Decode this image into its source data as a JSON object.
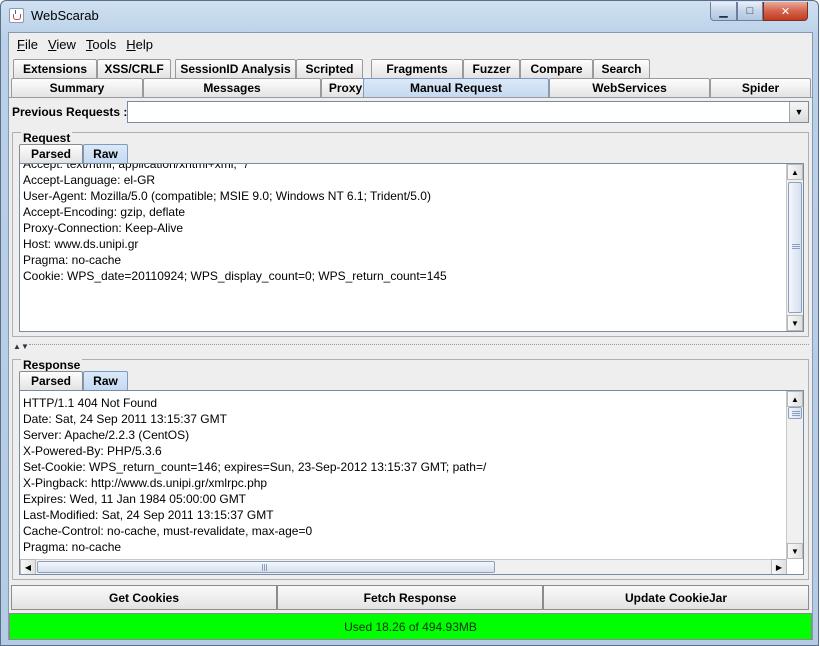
{
  "window": {
    "title": "WebScarab"
  },
  "menu": [
    {
      "label": "File",
      "accel": "F",
      "rest": "ile"
    },
    {
      "label": "View",
      "accel": "V",
      "rest": "iew"
    },
    {
      "label": "Tools",
      "accel": "T",
      "rest": "ools"
    },
    {
      "label": "Help",
      "accel": "H",
      "rest": "elp"
    }
  ],
  "tabs_row1": [
    "Extensions",
    "XSS/CRLF",
    "SessionID Analysis",
    "Scripted",
    "Fragments",
    "Fuzzer",
    "Compare",
    "Search"
  ],
  "tabs_row2": [
    "Summary",
    "Messages",
    "Proxy",
    "Manual Request",
    "WebServices",
    "Spider"
  ],
  "selected_tab": "Manual Request",
  "previous_requests": {
    "label": "Previous Requests :",
    "value": ""
  },
  "request": {
    "title": "Request",
    "subtabs": [
      "Parsed",
      "Raw"
    ],
    "selected_subtab": "Raw",
    "lines": [
      "Accept: text/html, application/xhtml+xml, */*",
      "Accept-Language: el-GR",
      "User-Agent: Mozilla/5.0 (compatible; MSIE 9.0; Windows NT 6.1; Trident/5.0)",
      "Accept-Encoding: gzip, deflate",
      "Proxy-Connection: Keep-Alive",
      "Host: www.ds.unipi.gr",
      "Pragma: no-cache",
      "Cookie: WPS_date=20110924; WPS_display_count=0; WPS_return_count=145"
    ]
  },
  "response": {
    "title": "Response",
    "subtabs": [
      "Parsed",
      "Raw"
    ],
    "selected_subtab": "Raw",
    "lines": [
      "HTTP/1.1 404 Not Found",
      "Date: Sat, 24 Sep 2011 13:15:37 GMT",
      "Server: Apache/2.2.3 (CentOS)",
      "X-Powered-By: PHP/5.3.6",
      "Set-Cookie: WPS_return_count=146; expires=Sun, 23-Sep-2012 13:15:37 GMT; path=/",
      "X-Pingback: http://www.ds.unipi.gr/xmlrpc.php",
      "Expires: Wed, 11 Jan 1984 05:00:00 GMT",
      "Last-Modified: Sat, 24 Sep 2011 13:15:37 GMT",
      "Cache-Control: no-cache, must-revalidate, max-age=0",
      "Pragma: no-cache"
    ]
  },
  "buttons": {
    "get_cookies": "Get Cookies",
    "fetch_response": "Fetch Response",
    "update_cookiejar": "Update CookieJar"
  },
  "status": {
    "memory": "Used 18.26 of 494.93MB",
    "color": "#00ff00"
  },
  "colors": {
    "selected_tab": "#c4d9f0",
    "status_bar": "#00ff00",
    "close_button": "#c23b22"
  }
}
